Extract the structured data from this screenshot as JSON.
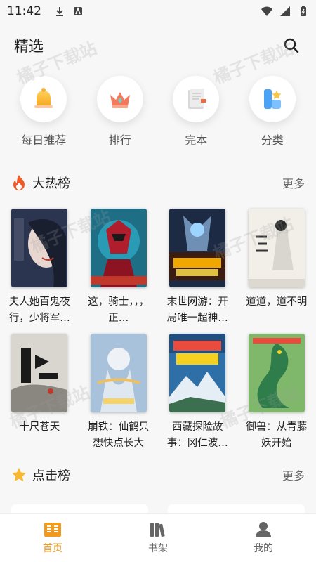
{
  "status_bar": {
    "time": "11:42"
  },
  "header": {
    "title": "精选"
  },
  "categories": [
    {
      "label": "每日推荐",
      "icon": "bell-icon"
    },
    {
      "label": "排行",
      "icon": "crown-icon"
    },
    {
      "label": "完本",
      "icon": "book-icon"
    },
    {
      "label": "分类",
      "icon": "category-icon"
    }
  ],
  "hot_section": {
    "title": "大热榜",
    "more": "更多",
    "icon": "flame-icon"
  },
  "hot_books": [
    {
      "title": "夫人她百鬼夜行，少将军…"
    },
    {
      "title": "这，骑士，，，正…"
    },
    {
      "title": "末世网游：开局唯一超神…"
    },
    {
      "title": "道道，道不明"
    },
    {
      "title": "十尺苍天"
    },
    {
      "title": "崩铁：仙鹤只想快点长大"
    },
    {
      "title": "西藏探险故事：冈仁波…"
    },
    {
      "title": "御兽：从青藤妖开始"
    }
  ],
  "click_section": {
    "title": "点击榜",
    "more": "更多",
    "icon": "star-icon"
  },
  "tabbar": [
    {
      "label": "首页",
      "active": true
    },
    {
      "label": "书架",
      "active": false
    },
    {
      "label": "我的",
      "active": false
    }
  ],
  "watermark": "橘子下载站",
  "colors": {
    "accent": "#f29a1c",
    "flame": "#f05a28",
    "star": "#f7b731"
  }
}
